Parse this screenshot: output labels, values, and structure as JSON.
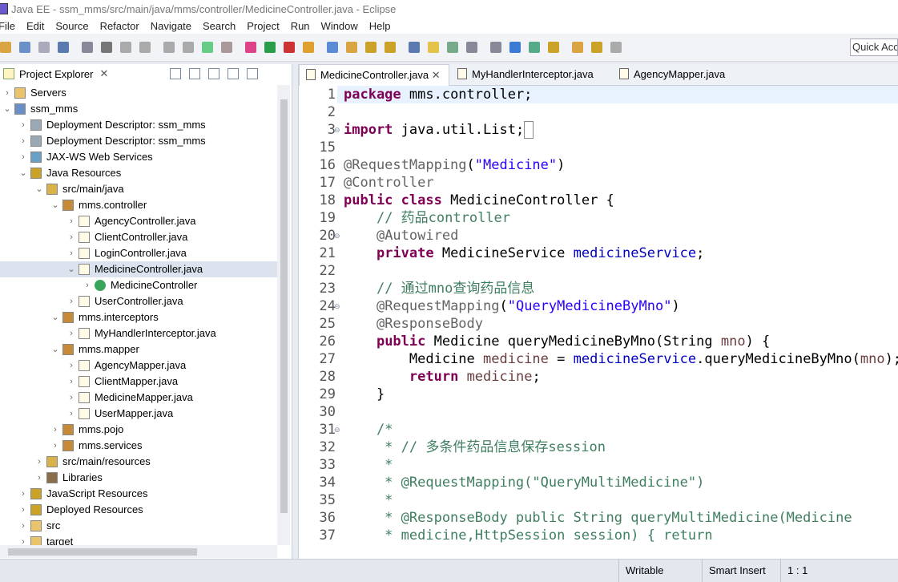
{
  "window": {
    "title": "Java EE - ssm_mms/src/main/java/mms/controller/MedicineController.java - Eclipse"
  },
  "menu": [
    "File",
    "Edit",
    "Source",
    "Refactor",
    "Navigate",
    "Search",
    "Project",
    "Run",
    "Window",
    "Help"
  ],
  "quick_access": {
    "placeholder": "Quick Access"
  },
  "project_explorer": {
    "tab_label": "Project Explorer",
    "items": [
      {
        "label": "Servers",
        "depth": 0,
        "expanded": false,
        "icon": "folder-icon"
      },
      {
        "label": "ssm_mms",
        "depth": 0,
        "expanded": true,
        "icon": "web-project-icon"
      },
      {
        "label": "Deployment Descriptor: ssm_mms",
        "depth": 1,
        "expanded": false,
        "icon": "descriptor-icon"
      },
      {
        "label": "Deployment Descriptor: ssm_mms",
        "depth": 1,
        "expanded": false,
        "icon": "descriptor-icon"
      },
      {
        "label": "JAX-WS Web Services",
        "depth": 1,
        "expanded": false,
        "icon": "webservice-icon"
      },
      {
        "label": "Java Resources",
        "depth": 1,
        "expanded": true,
        "icon": "java-resources-icon"
      },
      {
        "label": "src/main/java",
        "depth": 2,
        "expanded": true,
        "icon": "source-folder-icon"
      },
      {
        "label": "mms.controller",
        "depth": 3,
        "expanded": true,
        "icon": "package-icon"
      },
      {
        "label": "AgencyController.java",
        "depth": 4,
        "expanded": false,
        "icon": "java-file-icon"
      },
      {
        "label": "ClientController.java",
        "depth": 4,
        "expanded": false,
        "icon": "java-file-icon"
      },
      {
        "label": "LoginController.java",
        "depth": 4,
        "expanded": false,
        "icon": "java-file-icon"
      },
      {
        "label": "MedicineController.java",
        "depth": 4,
        "expanded": true,
        "icon": "java-file-icon",
        "selected": true
      },
      {
        "label": "MedicineController",
        "depth": 5,
        "expanded": false,
        "icon": "class-icon"
      },
      {
        "label": "UserController.java",
        "depth": 4,
        "expanded": false,
        "icon": "java-file-icon"
      },
      {
        "label": "mms.interceptors",
        "depth": 3,
        "expanded": true,
        "icon": "package-icon"
      },
      {
        "label": "MyHandlerInterceptor.java",
        "depth": 4,
        "expanded": false,
        "icon": "java-file-icon"
      },
      {
        "label": "mms.mapper",
        "depth": 3,
        "expanded": true,
        "icon": "package-icon"
      },
      {
        "label": "AgencyMapper.java",
        "depth": 4,
        "expanded": false,
        "icon": "interface-file-icon"
      },
      {
        "label": "ClientMapper.java",
        "depth": 4,
        "expanded": false,
        "icon": "interface-file-icon"
      },
      {
        "label": "MedicineMapper.java",
        "depth": 4,
        "expanded": false,
        "icon": "interface-file-icon"
      },
      {
        "label": "UserMapper.java",
        "depth": 4,
        "expanded": false,
        "icon": "interface-file-icon"
      },
      {
        "label": "mms.pojo",
        "depth": 3,
        "expanded": false,
        "icon": "package-icon"
      },
      {
        "label": "mms.services",
        "depth": 3,
        "expanded": false,
        "icon": "package-icon"
      },
      {
        "label": "src/main/resources",
        "depth": 2,
        "expanded": false,
        "icon": "source-folder-icon"
      },
      {
        "label": "Libraries",
        "depth": 2,
        "expanded": false,
        "icon": "library-icon"
      },
      {
        "label": "JavaScript Resources",
        "depth": 1,
        "expanded": false,
        "icon": "js-resources-icon"
      },
      {
        "label": "Deployed Resources",
        "depth": 1,
        "expanded": false,
        "icon": "deployed-icon"
      },
      {
        "label": "src",
        "depth": 1,
        "expanded": false,
        "icon": "folder-icon"
      },
      {
        "label": "target",
        "depth": 1,
        "expanded": false,
        "icon": "folder-icon"
      }
    ]
  },
  "editor": {
    "tabs": [
      {
        "label": "MedicineController.java",
        "active": true
      },
      {
        "label": "MyHandlerInterceptor.java",
        "active": false
      },
      {
        "label": "AgencyMapper.java",
        "active": false
      }
    ],
    "lines": [
      {
        "n": "1",
        "html": "<span class='k'>package</span> mms.controller;",
        "hl": true
      },
      {
        "n": "2",
        "html": ""
      },
      {
        "n": "3",
        "html": "<span class='k'>import</span> java.util.List;<span style='border:1px solid #888'>&nbsp;</span>",
        "fold": true
      },
      {
        "n": "15",
        "html": ""
      },
      {
        "n": "16",
        "html": "<span class='a'>@RequestMapping</span>(<span class='s'>\"Medicine\"</span>)"
      },
      {
        "n": "17",
        "html": "<span class='a'>@Controller</span>"
      },
      {
        "n": "18",
        "html": "<span class='k'>public</span> <span class='k'>class</span> MedicineController {"
      },
      {
        "n": "19",
        "html": "    <span class='c'>// 药品controller</span>"
      },
      {
        "n": "20",
        "html": "    <span class='a'>@Autowired</span>",
        "fold": true
      },
      {
        "n": "21",
        "html": "    <span class='k'>private</span> MedicineService <span class='f'>medicineService</span>;"
      },
      {
        "n": "22",
        "html": ""
      },
      {
        "n": "23",
        "html": "    <span class='c'>// 通过mno查询药品信息</span>"
      },
      {
        "n": "24",
        "html": "    <span class='a'>@RequestMapping</span>(<span class='s'>\"QueryMedicineByMno\"</span>)",
        "fold": true
      },
      {
        "n": "25",
        "html": "    <span class='a'>@ResponseBody</span>"
      },
      {
        "n": "26",
        "html": "    <span class='k'>public</span> Medicine queryMedicineByMno(String <span class='v'>mno</span>) {"
      },
      {
        "n": "27",
        "html": "        Medicine <span class='v'>medicine</span> = <span class='f'>medicineService</span>.queryMedicineByMno(<span class='v'>mno</span>);"
      },
      {
        "n": "28",
        "html": "        <span class='k'>return</span> <span class='v'>medicine</span>;"
      },
      {
        "n": "29",
        "html": "    }"
      },
      {
        "n": "30",
        "html": ""
      },
      {
        "n": "31",
        "html": "    <span class='c'>/*</span>",
        "fold": true
      },
      {
        "n": "32",
        "html": "<span class='c'>     * // 多条件药品信息保存session</span>"
      },
      {
        "n": "33",
        "html": "<span class='c'>     *</span>"
      },
      {
        "n": "34",
        "html": "<span class='c'>     * @RequestMapping(\"QueryMultiMedicine\")</span>"
      },
      {
        "n": "35",
        "html": "<span class='c'>     *</span>"
      },
      {
        "n": "36",
        "html": "<span class='c'>     * @ResponseBody public String queryMultiMedicine(Medicine</span>"
      },
      {
        "n": "37",
        "html": "<span class='c'>     * medicine,HttpSession session) { return</span>"
      }
    ]
  },
  "status": {
    "writable": "Writable",
    "insert_mode": "Smart Insert",
    "position": "1 : 1"
  },
  "colors": {
    "keyword": "#7f0055",
    "string": "#2a00ff",
    "comment": "#3f7f5f",
    "field": "#0000c0"
  }
}
